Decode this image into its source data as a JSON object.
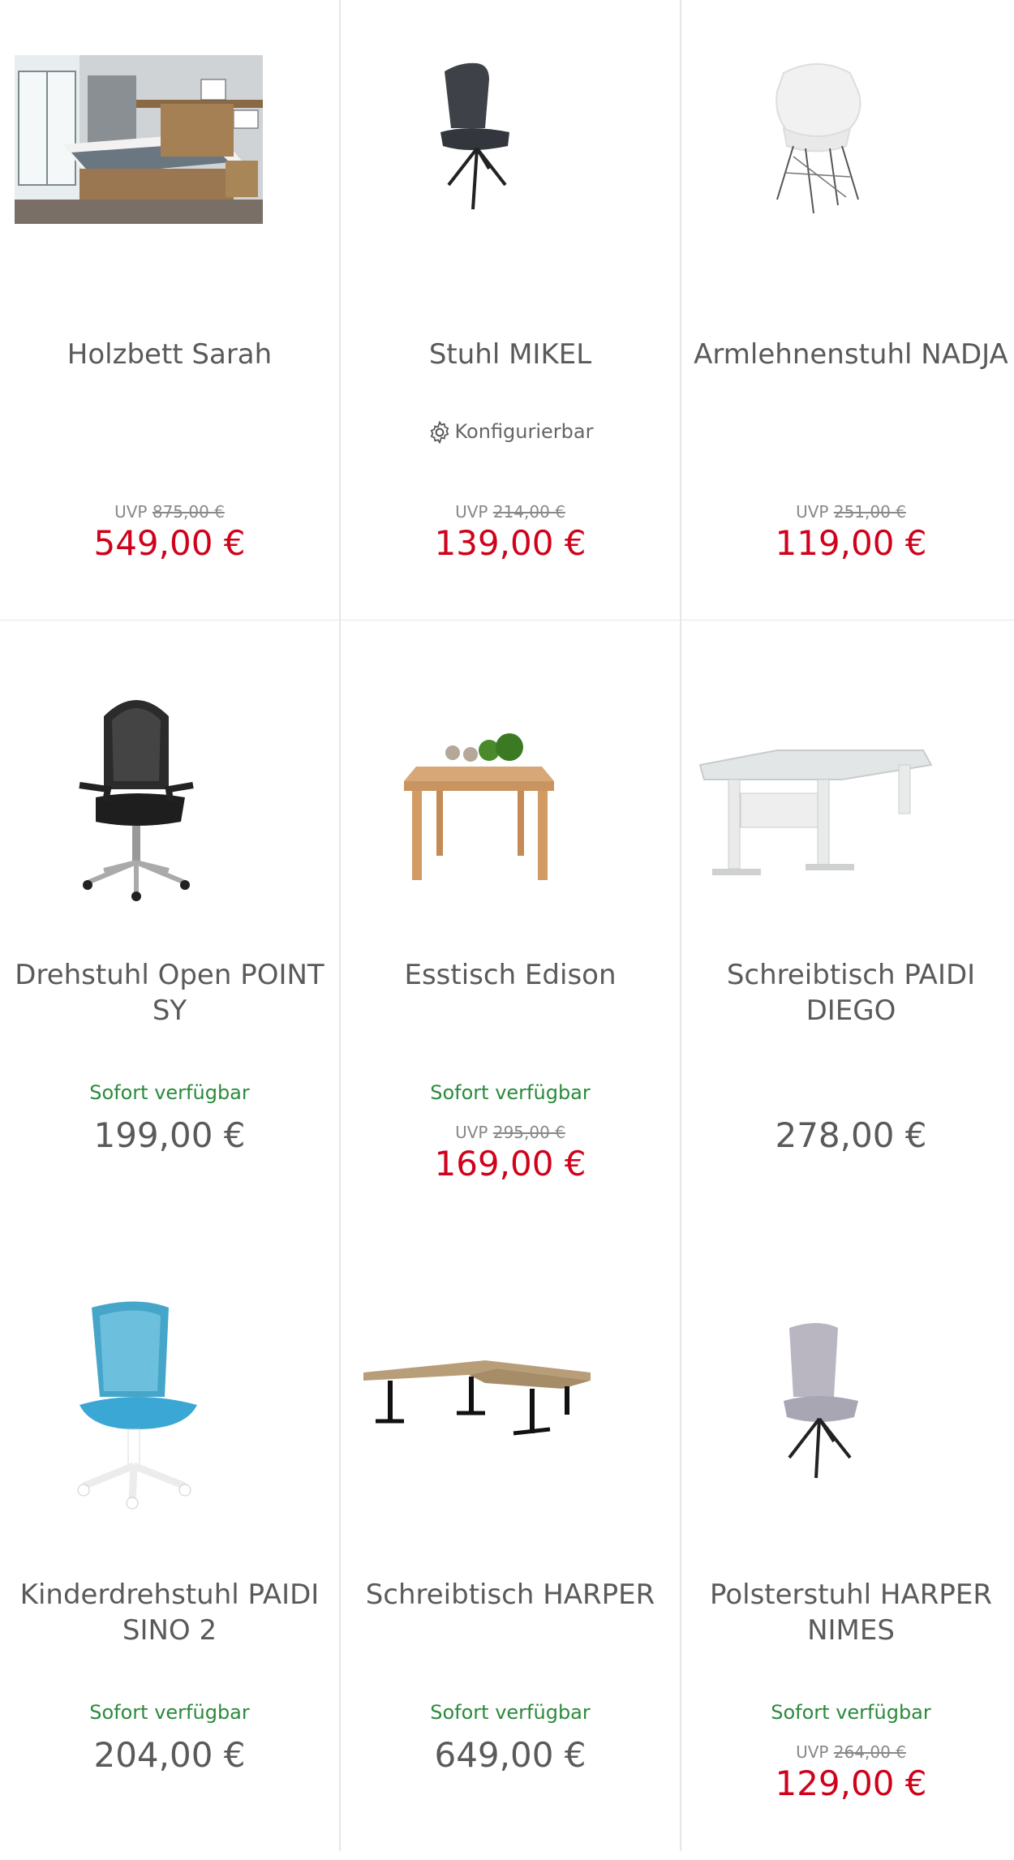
{
  "products": [
    {
      "name": "Holzbett Sarah",
      "uvp_label": "UVP",
      "uvp": "875,00 €",
      "price": "549,00 €",
      "image": "wooden-bed-image"
    },
    {
      "name": "Stuhl MIKEL",
      "badge": "Konfigurierbar",
      "uvp_label": "UVP",
      "uvp": "214,00 €",
      "price": "139,00 €",
      "image": "dark-chair-image"
    },
    {
      "name": "Armlehnenstuhl NADJA",
      "uvp_label": "UVP",
      "uvp": "251,00 €",
      "price": "119,00 €",
      "image": "white-shell-chair-image"
    },
    {
      "name": "Drehstuhl Open POINT SY",
      "availability": "Sofort verfügbar",
      "price": "199,00 €",
      "image": "office-chair-image"
    },
    {
      "name": "Esstisch Edison",
      "availability": "Sofort verfügbar",
      "uvp_label": "UVP",
      "uvp": "295,00 €",
      "price": "169,00 €",
      "image": "dining-table-image"
    },
    {
      "name": "Schreibtisch PAIDI DIEGO",
      "price": "278,00 €",
      "image": "kids-desk-image"
    },
    {
      "name": "Kinderdrehstuhl PAIDI SINO 2",
      "availability": "Sofort verfügbar",
      "price": "204,00 €",
      "image": "kids-swivel-chair-image"
    },
    {
      "name": "Schreibtisch HARPER",
      "availability": "Sofort verfügbar",
      "price": "649,00 €",
      "image": "corner-desk-image"
    },
    {
      "name": "Polsterstuhl HARPER NIMES",
      "availability": "Sofort verfügbar",
      "uvp_label": "UVP",
      "uvp": "264,00 €",
      "price": "129,00 €",
      "image": "grey-upholstered-chair-image"
    }
  ],
  "colors": {
    "sale": "#d0021b",
    "available": "#2a8a3b",
    "text": "#5a5a5a",
    "divider": "#e6e6e6"
  }
}
